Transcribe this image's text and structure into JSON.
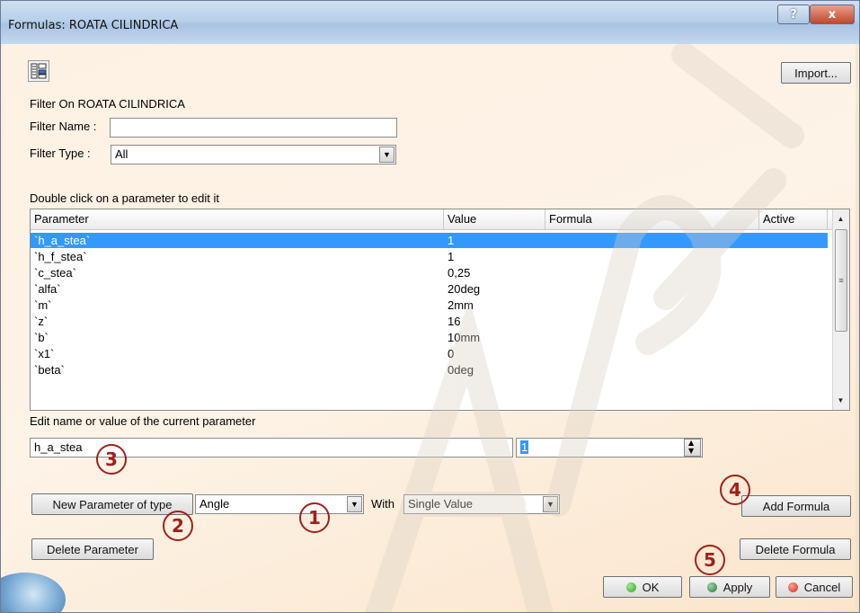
{
  "window": {
    "title": "Formulas: ROATA CILINDRICA",
    "help_label": "?",
    "close_label": "x"
  },
  "toolbar": {
    "import_label": "Import..."
  },
  "filter": {
    "heading": "Filter On ROATA CILINDRICA",
    "name_label": "Filter Name :",
    "name_value": "",
    "type_label": "Filter Type :",
    "type_value": "All"
  },
  "table": {
    "instruction": "Double click on a parameter to edit it",
    "columns": [
      "Parameter",
      "Value",
      "Formula",
      "Active"
    ],
    "rows": [
      {
        "parameter": "`h_a_stea`",
        "value": "1",
        "formula": "",
        "active": ""
      },
      {
        "parameter": "`h_f_stea`",
        "value": "1",
        "formula": "",
        "active": ""
      },
      {
        "parameter": "`c_stea`",
        "value": "0,25",
        "formula": "",
        "active": ""
      },
      {
        "parameter": "`alfa`",
        "value": "20deg",
        "formula": "",
        "active": ""
      },
      {
        "parameter": "`m`",
        "value": "2mm",
        "formula": "",
        "active": ""
      },
      {
        "parameter": "`z`",
        "value": "16",
        "formula": "",
        "active": ""
      },
      {
        "parameter": "`b`",
        "value": "10mm",
        "formula": "",
        "active": ""
      },
      {
        "parameter": "`x1`",
        "value": "0",
        "formula": "",
        "active": ""
      },
      {
        "parameter": "`beta`",
        "value": "0deg",
        "formula": "",
        "active": ""
      }
    ]
  },
  "edit": {
    "label": "Edit name or value of the current parameter",
    "name_value": "h_a_stea",
    "value_value": "1"
  },
  "new_param": {
    "button_label": "New Parameter of type",
    "type_value": "Angle",
    "with_label": "With",
    "with_value": "Single Value"
  },
  "buttons": {
    "add_formula": "Add Formula",
    "delete_parameter": "Delete Parameter",
    "delete_formula": "Delete Formula",
    "ok": "OK",
    "apply": "Apply",
    "cancel": "Cancel"
  },
  "annotations": [
    "1",
    "2",
    "3",
    "4",
    "5"
  ],
  "colors": {
    "selection": "#3399ff",
    "annotation": "#a0201c",
    "ok_dot": "#2fa52f",
    "apply_dot": "#2a7a3a",
    "cancel_dot": "#d22a1f"
  }
}
